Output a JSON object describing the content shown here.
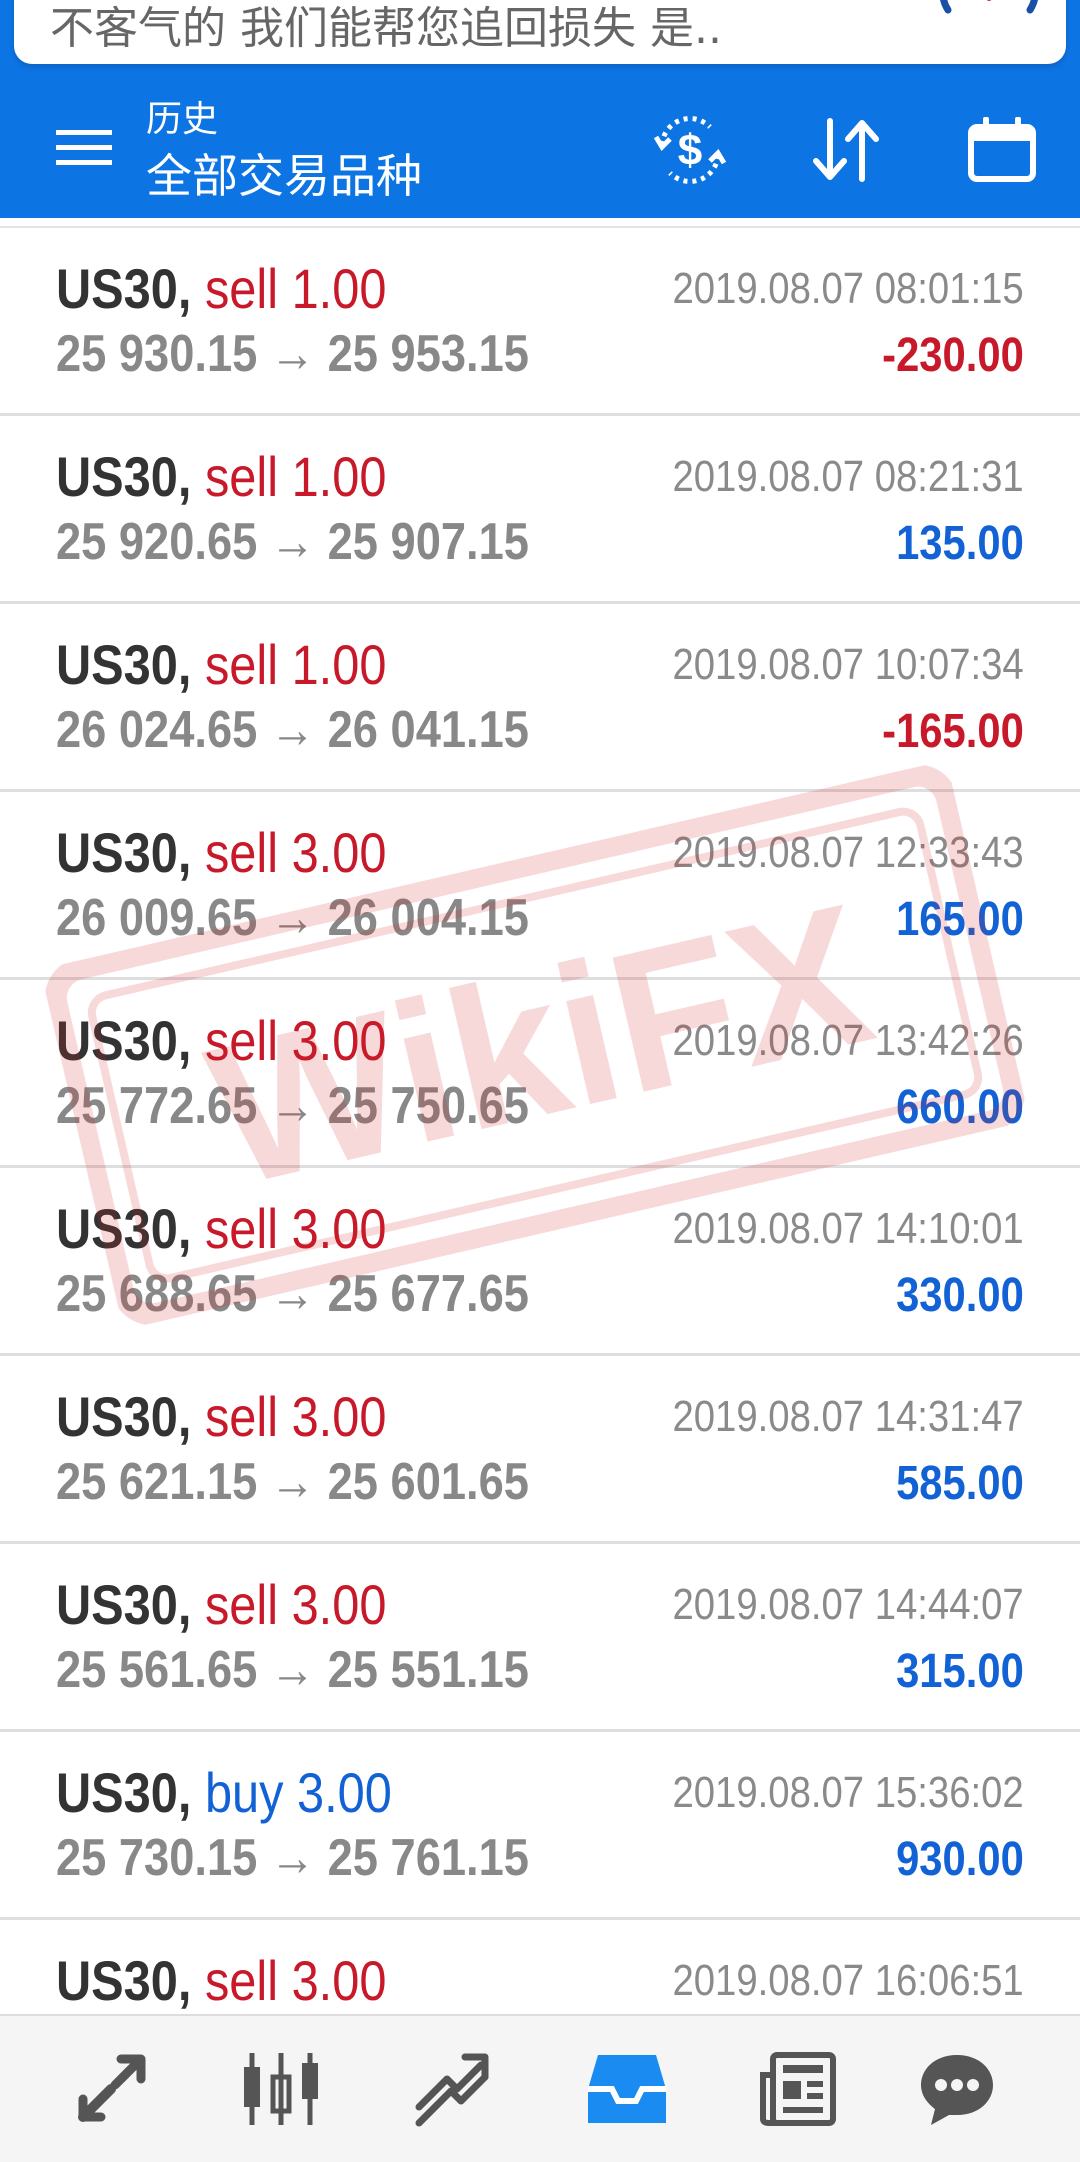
{
  "notification": {
    "text": "不客气的  我们能帮您追回损失  是.."
  },
  "app_bar": {
    "subtitle": "历史",
    "title": "全部交易品种"
  },
  "trades": [
    {
      "symbol": "US30,",
      "side": "sell",
      "volume": "sell 1.00",
      "prices": "25 930.15 → 25 953.15",
      "time": "2019.08.07 08:01:15",
      "profit": "-230.00"
    },
    {
      "symbol": "US30,",
      "side": "sell",
      "volume": "sell 1.00",
      "prices": "25 920.65 → 25 907.15",
      "time": "2019.08.07 08:21:31",
      "profit": "135.00"
    },
    {
      "symbol": "US30,",
      "side": "sell",
      "volume": "sell 1.00",
      "prices": "26 024.65 → 26 041.15",
      "time": "2019.08.07 10:07:34",
      "profit": "-165.00"
    },
    {
      "symbol": "US30,",
      "side": "sell",
      "volume": "sell 3.00",
      "prices": "26 009.65 → 26 004.15",
      "time": "2019.08.07 12:33:43",
      "profit": "165.00"
    },
    {
      "symbol": "US30,",
      "side": "sell",
      "volume": "sell 3.00",
      "prices": "25 772.65 → 25 750.65",
      "time": "2019.08.07 13:42:26",
      "profit": "660.00"
    },
    {
      "symbol": "US30,",
      "side": "sell",
      "volume": "sell 3.00",
      "prices": "25 688.65 → 25 677.65",
      "time": "2019.08.07 14:10:01",
      "profit": "330.00"
    },
    {
      "symbol": "US30,",
      "side": "sell",
      "volume": "sell 3.00",
      "prices": "25 621.15 → 25 601.65",
      "time": "2019.08.07 14:31:47",
      "profit": "585.00"
    },
    {
      "symbol": "US30,",
      "side": "sell",
      "volume": "sell 3.00",
      "prices": "25 561.65 → 25 551.15",
      "time": "2019.08.07 14:44:07",
      "profit": "315.00"
    },
    {
      "symbol": "US30,",
      "side": "buy",
      "volume": "buy 3.00",
      "prices": "25 730.15 → 25 761.15",
      "time": "2019.08.07 15:36:02",
      "profit": "930.00"
    },
    {
      "symbol": "US30,",
      "side": "sell",
      "volume": "sell 3.00",
      "prices": "",
      "time": "2019.08.07 16:06:51",
      "profit": ""
    }
  ],
  "watermark_text": "WikiFX",
  "bottom_nav": [
    {
      "icon": "quotes-icon",
      "active": false
    },
    {
      "icon": "charts-icon",
      "active": false
    },
    {
      "icon": "trade-icon",
      "active": false
    },
    {
      "icon": "history-icon",
      "active": true
    },
    {
      "icon": "news-icon",
      "active": false
    },
    {
      "icon": "chat-icon",
      "active": false
    }
  ],
  "colors": {
    "primary": "#0d74e4",
    "sell": "#c8192a",
    "buy": "#1262d6",
    "loss": "#c8192a",
    "profit": "#1262d6",
    "watermark": "#d2232a"
  }
}
